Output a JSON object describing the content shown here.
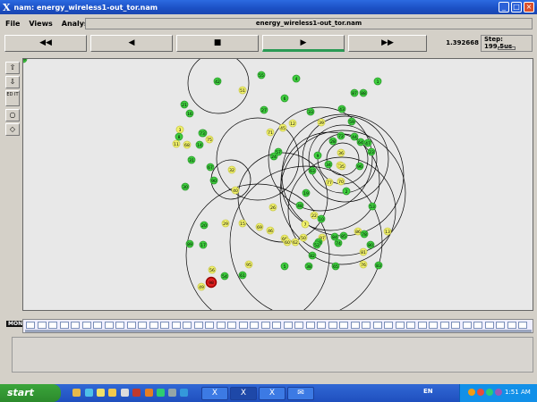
{
  "window": {
    "title": "nam: energy_wireless1-out_tor.nam",
    "minimize": "_",
    "maximize": "□",
    "close": "×"
  },
  "menu": [
    "File",
    "Views",
    "Analysis"
  ],
  "trace_file": "energy_wireless1-out_tor.nam",
  "controls": {
    "rewind": "◀◀",
    "back": "◀",
    "stop": "■",
    "play": "▶",
    "fastforward": "▶▶",
    "time": "1.392668",
    "step": "Step: 199.5us"
  },
  "tools": [
    "⇧",
    "⇩",
    "ED IT",
    "○",
    "◇"
  ],
  "timeline": {
    "label": "MONITOR"
  },
  "colors": {
    "node_green": "#3fcf3f",
    "node_yellow": "#f2f26c",
    "node_red": "#e02020",
    "range_circle": "#000000"
  },
  "nodes": [
    {
      "id": "42",
      "c": "g"
    },
    {
      "id": "51",
      "c": "y"
    },
    {
      "id": "55",
      "c": "g"
    },
    {
      "id": "4",
      "c": "g"
    },
    {
      "id": "1",
      "c": "g"
    },
    {
      "id": "21",
      "c": "g"
    },
    {
      "id": "16",
      "c": "g"
    },
    {
      "id": "6",
      "c": "g"
    },
    {
      "id": "87",
      "c": "g"
    },
    {
      "id": "88",
      "c": "g"
    },
    {
      "id": "33",
      "c": "g"
    },
    {
      "id": "43",
      "c": "g"
    },
    {
      "id": "27",
      "c": "g"
    },
    {
      "id": "39",
      "c": "y"
    },
    {
      "id": "12",
      "c": "y"
    },
    {
      "id": "45",
      "c": "y"
    },
    {
      "id": "59",
      "c": "g"
    },
    {
      "id": "91",
      "c": "g"
    },
    {
      "id": "3",
      "c": "y"
    },
    {
      "id": "8",
      "c": "g"
    },
    {
      "id": "75",
      "c": "y"
    },
    {
      "id": "11",
      "c": "y"
    },
    {
      "id": "31",
      "c": "g"
    },
    {
      "id": "67",
      "c": "g"
    },
    {
      "id": "73",
      "c": "g"
    },
    {
      "id": "71",
      "c": "y"
    },
    {
      "id": "57",
      "c": "g"
    },
    {
      "id": "28",
      "c": "g"
    },
    {
      "id": "64",
      "c": "g"
    },
    {
      "id": "23",
      "c": "g"
    },
    {
      "id": "36",
      "c": "y"
    },
    {
      "id": "18",
      "c": "y"
    },
    {
      "id": "34",
      "c": "g"
    },
    {
      "id": "72",
      "c": "g"
    },
    {
      "id": "44",
      "c": "g"
    },
    {
      "id": "47",
      "c": "g"
    },
    {
      "id": "9",
      "c": "g"
    },
    {
      "id": "63",
      "c": "g"
    },
    {
      "id": "24",
      "c": "g"
    },
    {
      "id": "40",
      "c": "y"
    },
    {
      "id": "32",
      "c": "y"
    },
    {
      "id": "68",
      "c": "y"
    },
    {
      "id": "14",
      "c": "g"
    },
    {
      "id": "35",
      "c": "y"
    },
    {
      "id": "96",
      "c": "g"
    },
    {
      "id": "30",
      "c": "g"
    },
    {
      "id": "90",
      "c": "g"
    },
    {
      "id": "77",
      "c": "y"
    },
    {
      "id": "70",
      "c": "y"
    },
    {
      "id": "2",
      "c": "g"
    },
    {
      "id": "19",
      "c": "g"
    },
    {
      "id": "48",
      "c": "g"
    },
    {
      "id": "10",
      "c": "g"
    },
    {
      "id": "74",
      "c": "g"
    },
    {
      "id": "38",
      "c": "g"
    },
    {
      "id": "29",
      "c": "y"
    },
    {
      "id": "20",
      "c": "g"
    },
    {
      "id": "15",
      "c": "y"
    },
    {
      "id": "69",
      "c": "y"
    },
    {
      "id": "46",
      "c": "y"
    },
    {
      "id": "66",
      "c": "y"
    },
    {
      "id": "62",
      "c": "y"
    },
    {
      "id": "50",
      "c": "y"
    },
    {
      "id": "22",
      "c": "y"
    },
    {
      "id": "97",
      "c": "y"
    },
    {
      "id": "58",
      "c": "g"
    },
    {
      "id": "52",
      "c": "g"
    },
    {
      "id": "84",
      "c": "g"
    },
    {
      "id": "85",
      "c": "g"
    },
    {
      "id": "86",
      "c": "y"
    },
    {
      "id": "78",
      "c": "g"
    },
    {
      "id": "80",
      "c": "g"
    },
    {
      "id": "81",
      "c": "y"
    },
    {
      "id": "82",
      "c": "g"
    },
    {
      "id": "65",
      "c": "g"
    },
    {
      "id": "76",
      "c": "y"
    },
    {
      "id": "89",
      "c": "g"
    },
    {
      "id": "95",
      "c": "y"
    },
    {
      "id": "60",
      "c": "y"
    },
    {
      "id": "5",
      "c": "g"
    },
    {
      "id": "7",
      "c": "y"
    },
    {
      "id": "26",
      "c": "y"
    },
    {
      "id": "53",
      "c": "g"
    },
    {
      "id": "83",
      "c": "g"
    },
    {
      "id": "13",
      "c": "y"
    },
    {
      "id": "17",
      "c": "g"
    },
    {
      "id": "56",
      "c": "y"
    },
    {
      "id": "54",
      "c": "g"
    },
    {
      "id": "61",
      "c": "g"
    },
    {
      "id": "98",
      "c": "r"
    },
    {
      "id": "49",
      "c": "y"
    },
    {
      "id": "99",
      "c": "g"
    }
  ],
  "taskbar": {
    "start": "start",
    "lang": "EN",
    "clock": "1:51 AM",
    "tasks": [
      "X",
      "X",
      "X",
      "✉"
    ]
  }
}
